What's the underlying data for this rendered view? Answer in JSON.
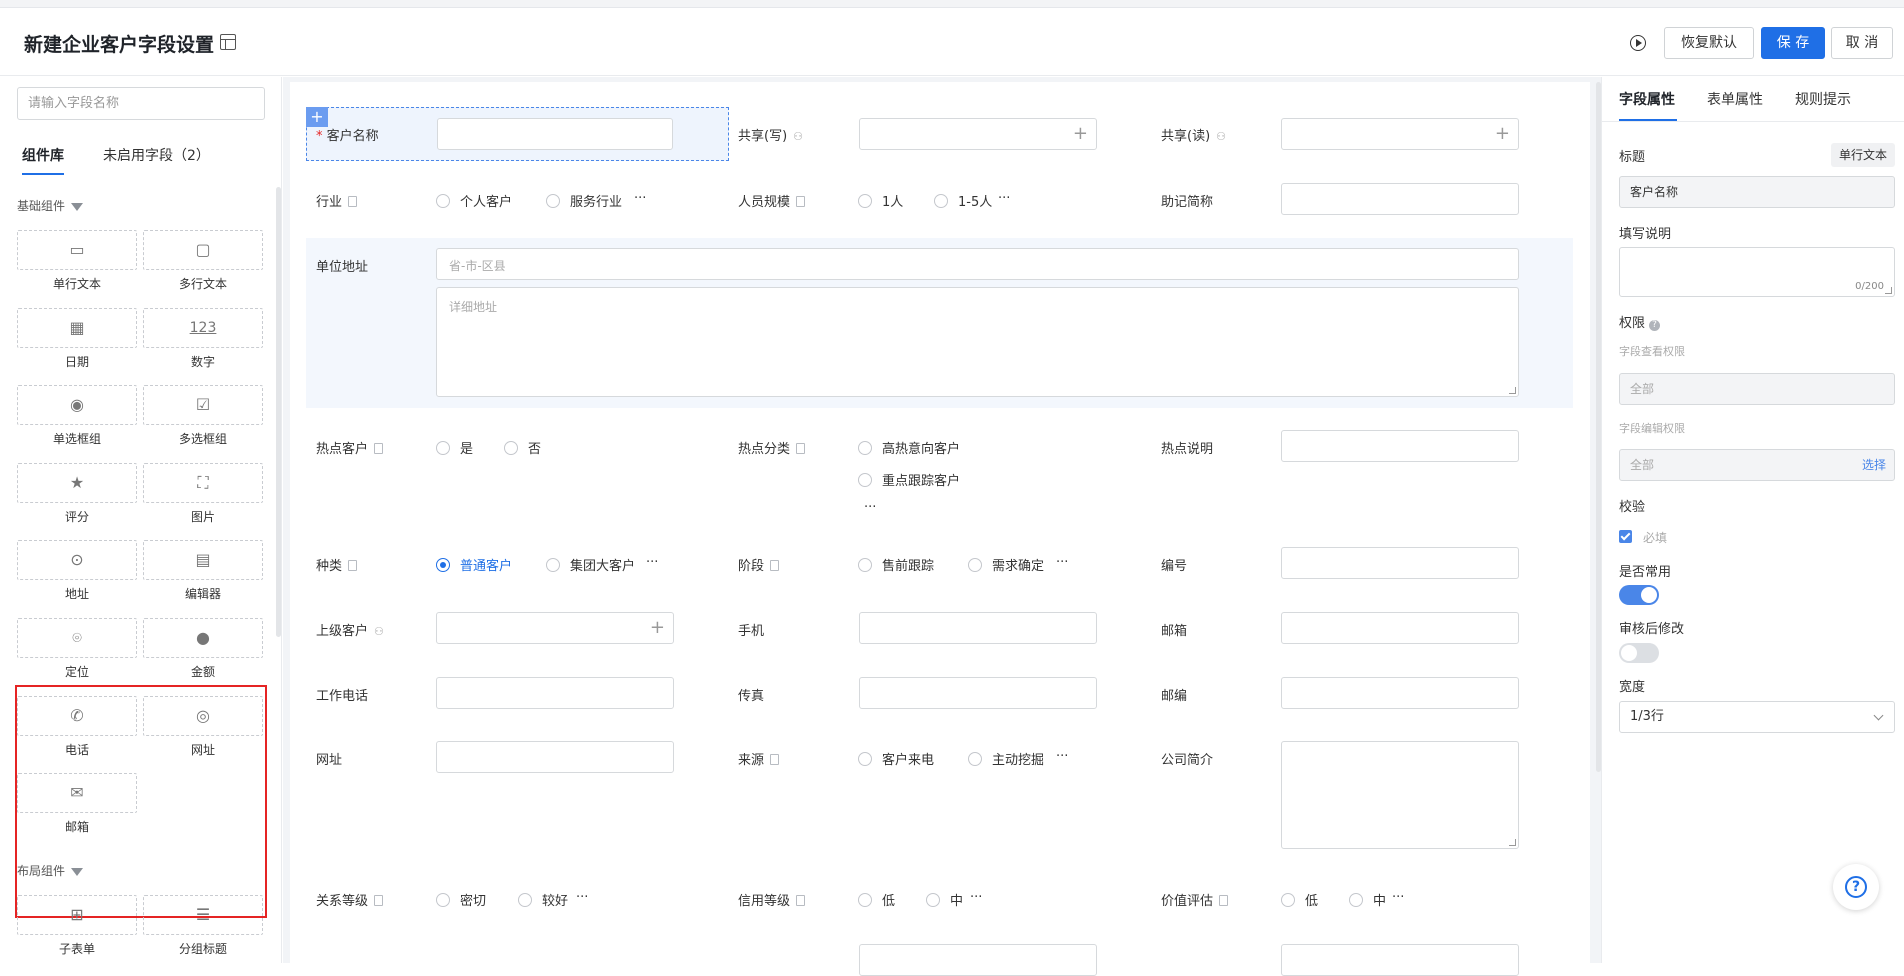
{
  "header": {
    "title": "新建企业客户字段设置",
    "restore_label": "恢复默认",
    "save_label": "保 存",
    "cancel_label": "取 消"
  },
  "left": {
    "search_placeholder": "请输入字段名称",
    "tabs": [
      "组件库",
      "未启用字段（2）"
    ],
    "sections": {
      "basic": "基础组件",
      "layout": "布局组件"
    },
    "components": [
      {
        "label": "单行文本",
        "icon": "single-line-text-icon"
      },
      {
        "label": "多行文本",
        "icon": "multi-line-text-icon"
      },
      {
        "label": "日期",
        "icon": "calendar-icon"
      },
      {
        "label": "数字",
        "icon": "number-icon"
      },
      {
        "label": "单选框组",
        "icon": "radio-icon"
      },
      {
        "label": "多选框组",
        "icon": "checkbox-icon"
      },
      {
        "label": "评分",
        "icon": "star-icon"
      },
      {
        "label": "图片",
        "icon": "image-icon"
      },
      {
        "label": "地址",
        "icon": "map-pin-icon"
      },
      {
        "label": "编辑器",
        "icon": "editor-icon"
      },
      {
        "label": "定位",
        "icon": "location-icon"
      },
      {
        "label": "金额",
        "icon": "money-icon"
      },
      {
        "label": "电话",
        "icon": "phone-icon"
      },
      {
        "label": "网址",
        "icon": "browser-icon"
      },
      {
        "label": "邮箱",
        "icon": "mail-icon"
      }
    ],
    "layout_components": [
      {
        "label": "子表单",
        "icon": "table-icon"
      },
      {
        "label": "分组标题",
        "icon": "group-title-icon"
      }
    ]
  },
  "form": {
    "customer_name": "客户名称",
    "share_write": "共享(写)",
    "share_read": "共享(读)",
    "industry": "行业",
    "industry_opts": [
      "个人客户",
      "服务行业"
    ],
    "staff_size": "人员规模",
    "staff_opts": [
      "1人",
      "1-5人"
    ],
    "mnemonic": "助记简称",
    "address": "单位地址",
    "address_region_ph": "省-市-区县",
    "address_detail_ph": "详细地址",
    "hot_customer": "热点客户",
    "hot_opts": [
      "是",
      "否"
    ],
    "hot_category": "热点分类",
    "hot_cat_opts": [
      "高热意向客户",
      "重点跟踪客户"
    ],
    "hot_desc": "热点说明",
    "kind": "种类",
    "kind_opts": [
      "普通客户",
      "集团大客户"
    ],
    "stage": "阶段",
    "stage_opts": [
      "售前跟踪",
      "需求确定"
    ],
    "serial": "编号",
    "parent_customer": "上级客户",
    "mobile": "手机",
    "email": "邮箱",
    "work_phone": "工作电话",
    "fax": "传真",
    "postcode": "邮编",
    "website": "网址",
    "source": "来源",
    "source_opts": [
      "客户来电",
      "主动挖掘"
    ],
    "intro": "公司简介",
    "relation": "关系等级",
    "relation_opts": [
      "密切",
      "较好"
    ],
    "credit": "信用等级",
    "credit_opts": [
      "低",
      "中"
    ],
    "value": "价值评估",
    "value_opts": [
      "低",
      "中"
    ],
    "more": "···"
  },
  "right": {
    "tabs": [
      "字段属性",
      "表单属性",
      "规则提示"
    ],
    "title_label": "标题",
    "type_badge": "单行文本",
    "title_value": "客户名称",
    "desc_label": "填写说明",
    "desc_count": "0/200",
    "perm_label": "权限",
    "view_perm_label": "字段查看权限",
    "view_perm_value": "全部",
    "edit_perm_label": "字段编辑权限",
    "edit_perm_value": "全部",
    "select_link": "选择",
    "validate_label": "校验",
    "required_label": "必填",
    "common_label": "是否常用",
    "audit_label": "审核后修改",
    "width_label": "宽度",
    "width_value": "1/3行"
  }
}
